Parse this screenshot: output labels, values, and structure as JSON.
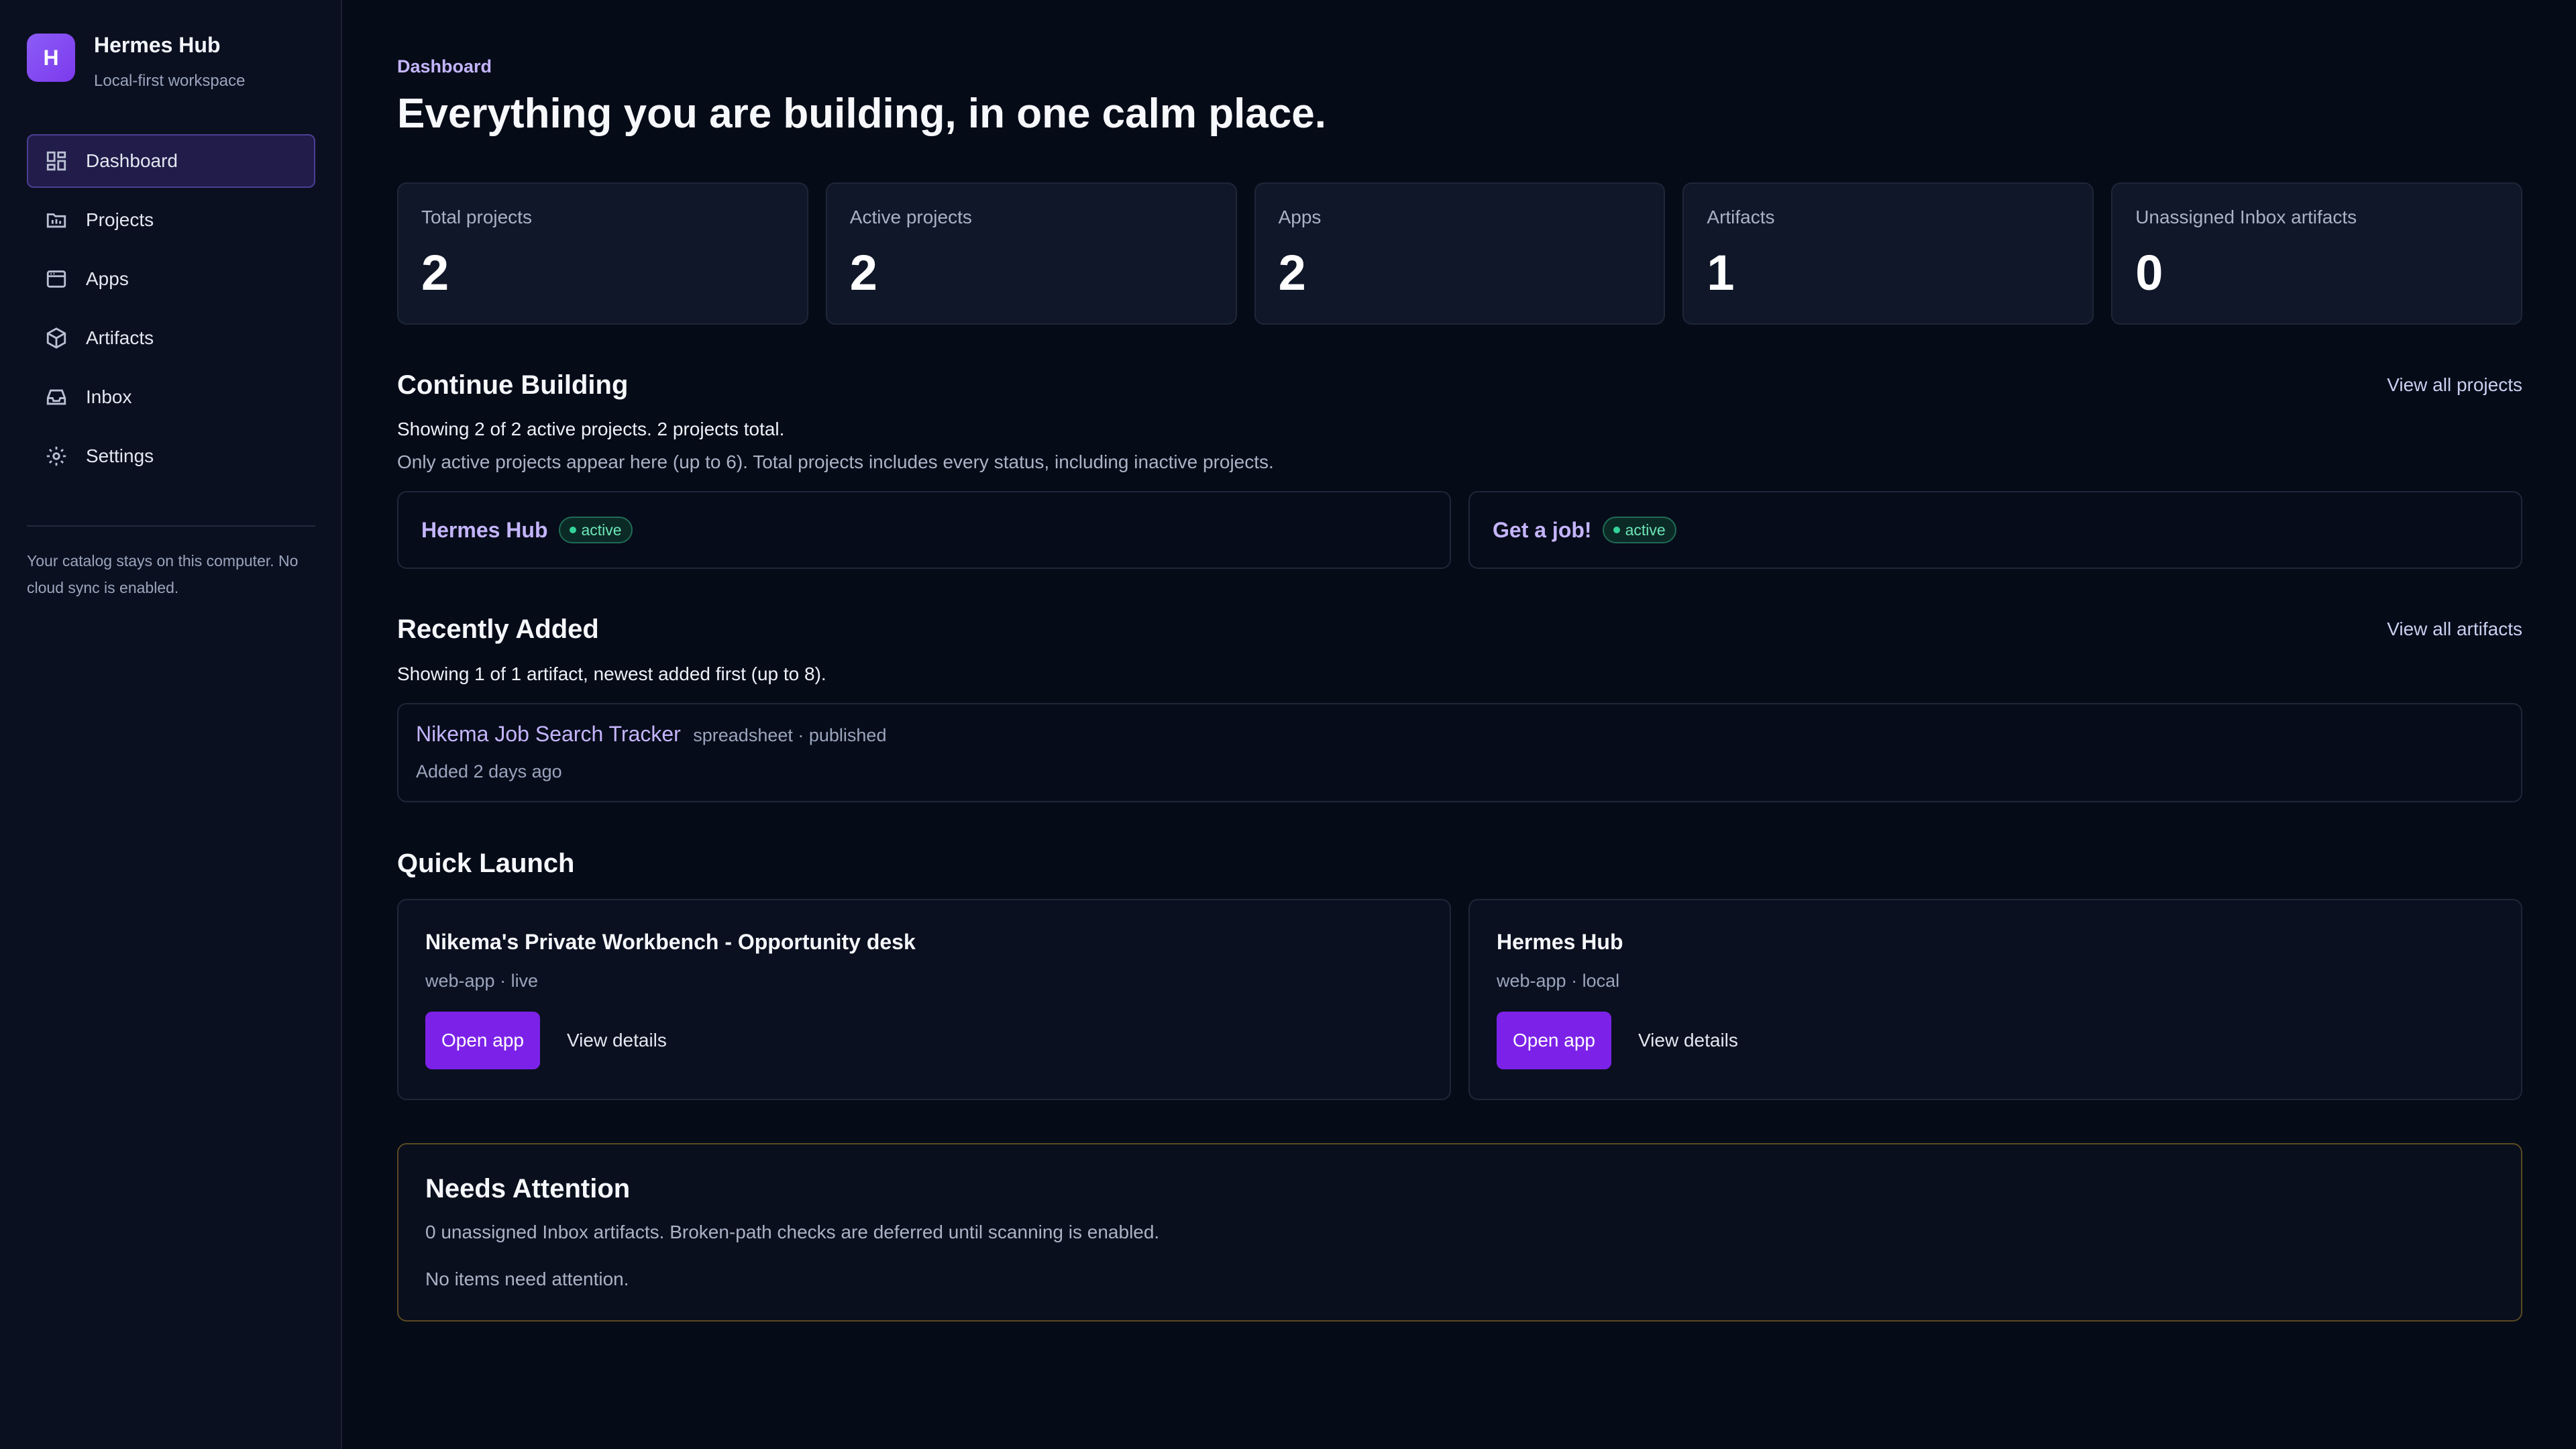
{
  "brand": {
    "initial": "H",
    "name": "Hermes Hub",
    "subtitle": "Local-first workspace"
  },
  "sidebar": {
    "items": [
      {
        "label": "Dashboard",
        "icon": "dashboard-icon",
        "active": true
      },
      {
        "label": "Projects",
        "icon": "projects-icon"
      },
      {
        "label": "Apps",
        "icon": "apps-icon"
      },
      {
        "label": "Artifacts",
        "icon": "artifacts-icon"
      },
      {
        "label": "Inbox",
        "icon": "inbox-icon"
      },
      {
        "label": "Settings",
        "icon": "gear-icon"
      }
    ],
    "note": "Your catalog stays on this computer. No cloud sync is enabled."
  },
  "header": {
    "eyebrow": "Dashboard",
    "title": "Everything you are building, in one calm place."
  },
  "stats": [
    {
      "label": "Total projects",
      "value": "2"
    },
    {
      "label": "Active projects",
      "value": "2"
    },
    {
      "label": "Apps",
      "value": "2"
    },
    {
      "label": "Artifacts",
      "value": "1"
    },
    {
      "label": "Unassigned Inbox artifacts",
      "value": "0"
    }
  ],
  "continue_building": {
    "title": "Continue Building",
    "link": "View all projects",
    "summary": "Showing 2 of 2 active projects. 2 projects total.",
    "note": "Only active projects appear here (up to 6). Total projects includes every status, including inactive projects.",
    "projects": [
      {
        "name": "Hermes Hub",
        "status": "active"
      },
      {
        "name": "Get a job!",
        "status": "active"
      }
    ]
  },
  "recently_added": {
    "title": "Recently Added",
    "link": "View all artifacts",
    "summary": "Showing 1 of 1 artifact, newest added first (up to 8).",
    "artifacts": [
      {
        "name": "Nikema Job Search Tracker",
        "meta": "spreadsheet · published",
        "added": "Added 2 days ago"
      }
    ]
  },
  "quick_launch": {
    "title": "Quick Launch",
    "apps": [
      {
        "name": "Nikema's Private Workbench - Opportunity desk",
        "meta": "web-app · live",
        "open_label": "Open app",
        "details_label": "View details"
      },
      {
        "name": "Hermes Hub",
        "meta": "web-app · local",
        "open_label": "Open app",
        "details_label": "View details"
      }
    ]
  },
  "needs_attention": {
    "title": "Needs Attention",
    "description": "0 unassigned Inbox artifacts. Broken-path checks are deferred until scanning is enabled.",
    "empty": "No items need attention."
  },
  "colors": {
    "accent": "#7c22e8",
    "link": "#c4b5fd",
    "success": "#34d399",
    "background": "#060b18",
    "warning_border": "#5a4a22"
  }
}
